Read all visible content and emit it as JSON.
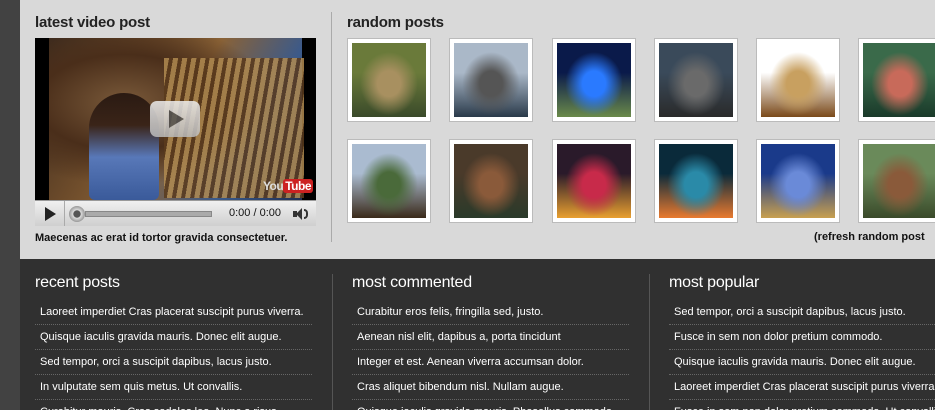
{
  "video": {
    "section_title": "latest video post",
    "time": "0:00 / 0:00",
    "youtube_logo": "You",
    "youtube_logo_tube": "Tube",
    "caption": "Maecenas ac erat id tortor gravida consectetuer."
  },
  "random": {
    "section_title": "random posts",
    "refresh_label": "(refresh random post",
    "thumbnails": [
      {
        "name": "thumb-statue",
        "colors": [
          "#6a7a3a",
          "#a89060",
          "#3a4a2a"
        ]
      },
      {
        "name": "thumb-volcano",
        "colors": [
          "#aab8c8",
          "#555",
          "#2a3a4a"
        ]
      },
      {
        "name": "thumb-monument",
        "colors": [
          "#0a1a4a",
          "#2a7aff",
          "#6a8a4a"
        ]
      },
      {
        "name": "thumb-temple",
        "colors": [
          "#3a4a5a",
          "#6a6a6a",
          "#2a2a2a"
        ]
      },
      {
        "name": "thumb-instruments",
        "colors": [
          "#fff",
          "#c8a060",
          "#7a4a1a"
        ]
      },
      {
        "name": "thumb-reef",
        "colors": [
          "#3a6a4a",
          "#c86a5a",
          "#1a3a2a"
        ]
      },
      {
        "name": "thumb-house",
        "colors": [
          "#aabbd0",
          "#4a6a3a",
          "#3a2a1a"
        ]
      },
      {
        "name": "thumb-dancers",
        "colors": [
          "#4a3a2a",
          "#8a5a3a",
          "#2a3a2a"
        ]
      },
      {
        "name": "thumb-market",
        "colors": [
          "#2a1a2a",
          "#c82a4a",
          "#e8a030"
        ]
      },
      {
        "name": "thumb-fish",
        "colors": [
          "#0a2a3a",
          "#2a8aa8",
          "#e87a30"
        ]
      },
      {
        "name": "thumb-coral",
        "colors": [
          "#1a3a8a",
          "#6a8ad8",
          "#c8a050"
        ]
      },
      {
        "name": "thumb-tribesman",
        "colors": [
          "#6a8a5a",
          "#8a5a3a",
          "#3a4a2a"
        ]
      }
    ]
  },
  "columns": [
    {
      "title": "recent posts",
      "items": [
        "Laoreet imperdiet Cras placerat suscipit purus viverra.",
        "Quisque iaculis gravida mauris. Donec elit augue.",
        "Sed tempor, orci a suscipit dapibus, lacus justo.",
        "In vulputate sem quis metus. Ut convallis.",
        "Curabitur mauris. Cras sodales leo. Nunc a risus."
      ]
    },
    {
      "title": "most commented",
      "items": [
        "Curabitur eros felis, fringilla sed, justo.",
        "Aenean nisl elit, dapibus a, porta tincidunt",
        "Integer et est. Aenean viverra accumsan dolor.",
        "Cras aliquet bibendum nisl. Nullam augue.",
        "Quisque iaculis gravida mauris. Phasellus commodo."
      ]
    },
    {
      "title": "most popular",
      "items": [
        "Sed tempor, orci a suscipit dapibus, lacus justo.",
        "Fusce in sem non dolor pretium commodo.",
        "Quisque iaculis gravida mauris. Donec elit augue.",
        "Laoreet imperdiet Cras placerat suscipit purus viverra.",
        "Fusce in sem non dolor pretium commodo. Ut convallis."
      ]
    }
  ]
}
